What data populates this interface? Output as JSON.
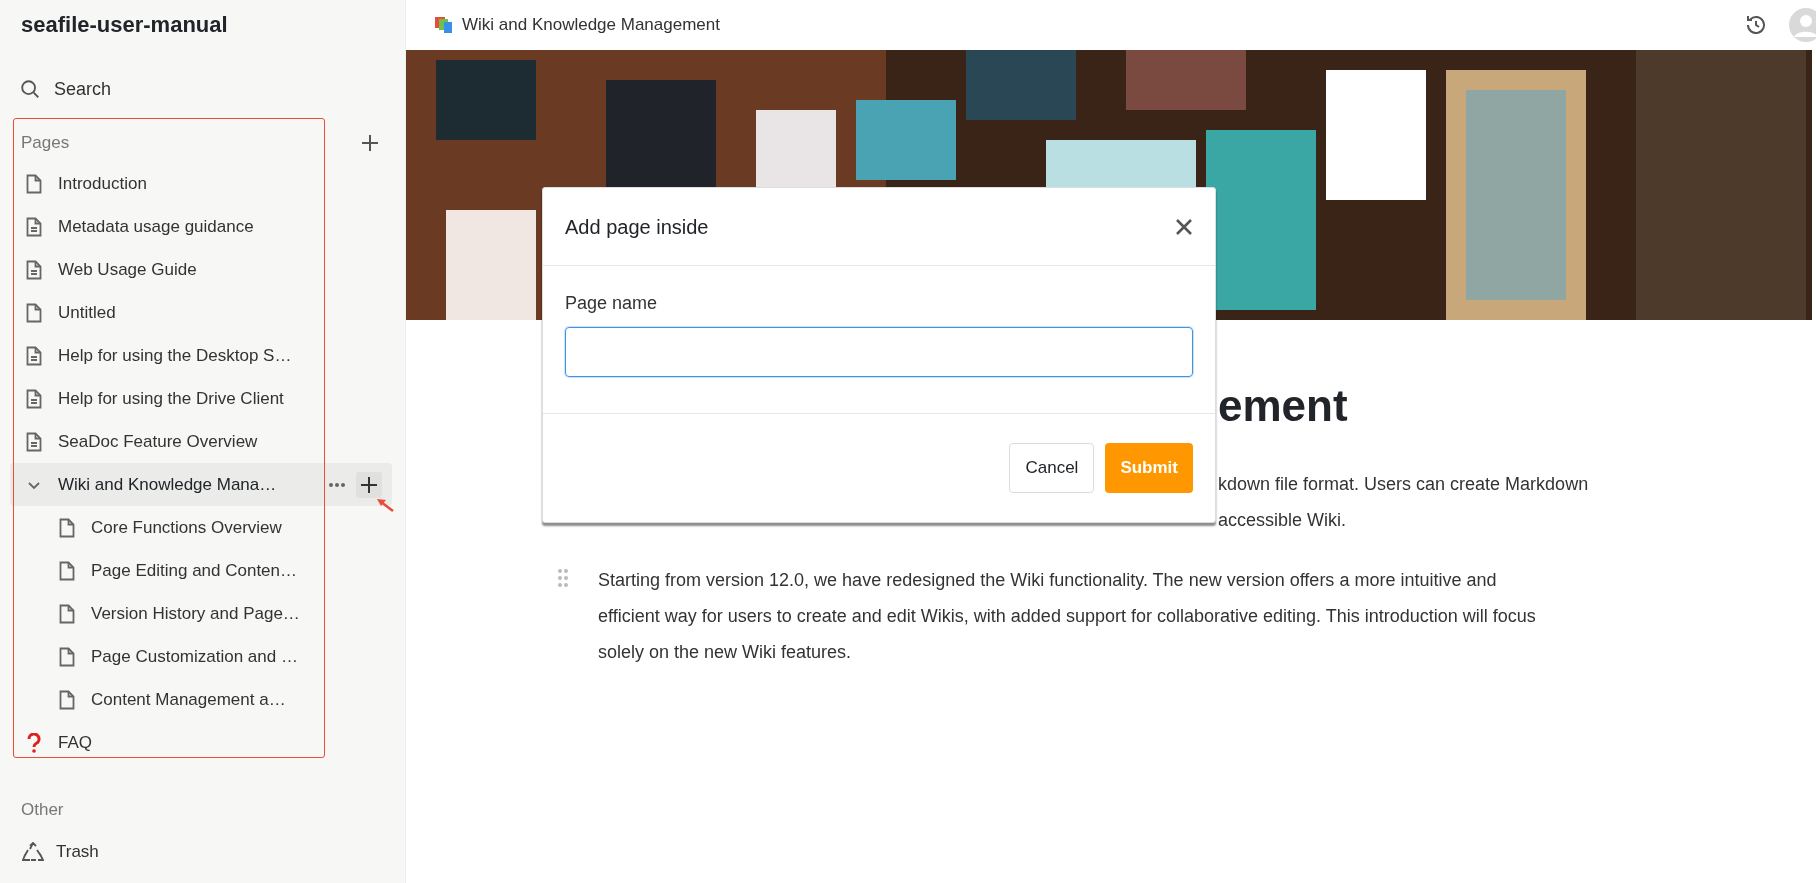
{
  "sidebar": {
    "title": "seafile-user-manual",
    "search": "Search",
    "pages_label": "Pages",
    "pages": [
      {
        "kind": "blank",
        "label": "Introduction",
        "selected": false
      },
      {
        "kind": "text",
        "label": "Metadata usage guidance",
        "selected": false
      },
      {
        "kind": "text",
        "label": "Web Usage Guide",
        "selected": false
      },
      {
        "kind": "blank",
        "label": "Untitled",
        "selected": false
      },
      {
        "kind": "text",
        "label": "Help for using the Desktop S…",
        "selected": false
      },
      {
        "kind": "text",
        "label": "Help for using the Drive Client",
        "selected": false
      },
      {
        "kind": "text",
        "label": "SeaDoc Feature Overview",
        "selected": false
      },
      {
        "kind": "group",
        "label": "Wiki and Knowledge Mana…",
        "selected": true,
        "expanded": true,
        "children": [
          {
            "kind": "blank",
            "label": "Core Functions Overview",
            "selected": false
          },
          {
            "kind": "blank",
            "label": "Page Editing and Conten…",
            "selected": false
          },
          {
            "kind": "blank",
            "label": "Version History and Page…",
            "selected": false
          },
          {
            "kind": "blank",
            "label": "Page Customization and …",
            "selected": false
          },
          {
            "kind": "blank",
            "label": "Content Management a…",
            "selected": false
          }
        ]
      },
      {
        "kind": "faq",
        "label": "FAQ",
        "selected": false
      }
    ],
    "other_label": "Other",
    "other": [
      {
        "label": "Trash"
      }
    ]
  },
  "header": {
    "title": "Wiki and Knowledge Management"
  },
  "article": {
    "heading": "ement",
    "fragments": [
      "kdown file format. Users can create Markdown",
      "accessible Wiki."
    ],
    "paragraph": "Starting from version 12.0, we have redesigned the Wiki functionality. The new version offers a more intuitive and efficient way for users to create and edit Wikis, with added support for collaborative editing. This introduction will focus solely on the new Wiki features."
  },
  "dialog": {
    "title": "Add page inside",
    "field_label": "Page name",
    "buttons": [
      {
        "label": "Cancel",
        "kind": "secondary"
      },
      {
        "label": "Submit",
        "kind": "primary"
      }
    ]
  }
}
